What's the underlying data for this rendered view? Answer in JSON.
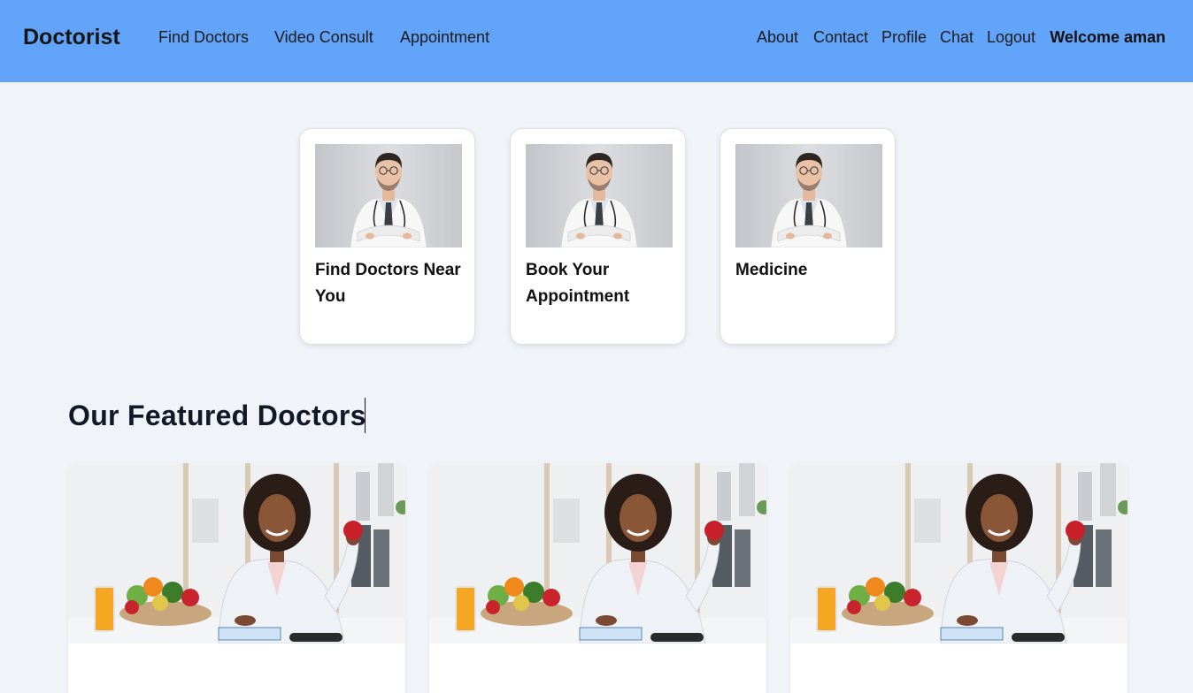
{
  "navbar": {
    "brand": "Doctorist",
    "left_links": [
      "Find Doctors",
      "Video Consult",
      "Appointment"
    ],
    "right_links": [
      "About",
      "Contact",
      "Profile",
      "Chat",
      "Logout"
    ],
    "welcome": "Welcome aman",
    "background_color": "#62a4fa"
  },
  "services": [
    {
      "title": "Find Doctors Near You"
    },
    {
      "title": "Book Your Appointment"
    },
    {
      "title": "Medicine"
    }
  ],
  "featured": {
    "heading": "Our Featured Doctors",
    "doctor_count_visible": 3
  }
}
